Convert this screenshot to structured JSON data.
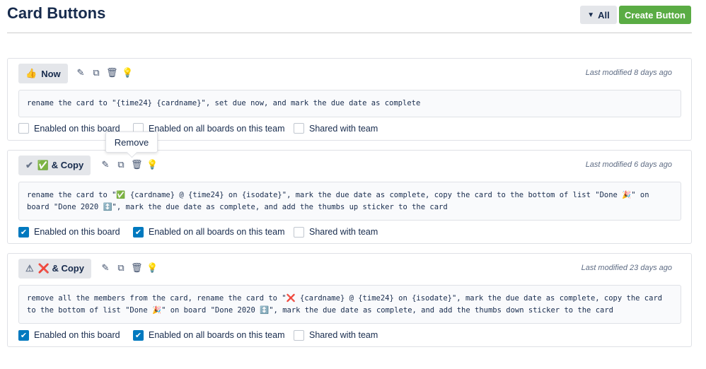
{
  "header": {
    "title": "Card Buttons",
    "filter_label": "All",
    "create_label": "Create Button"
  },
  "tooltip": "Remove",
  "options_labels": [
    "Enabled on this board",
    "Enabled on all boards on this team",
    "Shared with team"
  ],
  "cards": [
    {
      "icon": "👍",
      "label": "Now",
      "modified": "Last modified 8 days ago",
      "description": "rename the card to \"{time24} {cardname}\", set due now, and mark the due date as complete",
      "checked": [
        false,
        false,
        false
      ]
    },
    {
      "icon": "✔",
      "label": "✅ & Copy",
      "modified": "Last modified 6 days ago",
      "description": "rename the card to \"✅ {cardname} @ {time24} on {isodate}\", mark the due date as complete, copy the card to the bottom of list \"Done 🎉\" on board \"Done 2020 ↕️\", mark the due date as complete, and add the thumbs up sticker to the card",
      "checked": [
        true,
        true,
        false
      ]
    },
    {
      "icon": "⚠",
      "label": "❌ & Copy",
      "modified": "Last modified 23 days ago",
      "description": "remove all the members from the card, rename the card to \"❌ {cardname} @ {time24} on {isodate}\", mark the due date as complete, copy the card to the bottom of list \"Done 🎉\" on board \"Done 2020 ↕️\", mark the due date as complete, and add the thumbs down sticker to the card",
      "checked": [
        true,
        true,
        false
      ]
    }
  ]
}
